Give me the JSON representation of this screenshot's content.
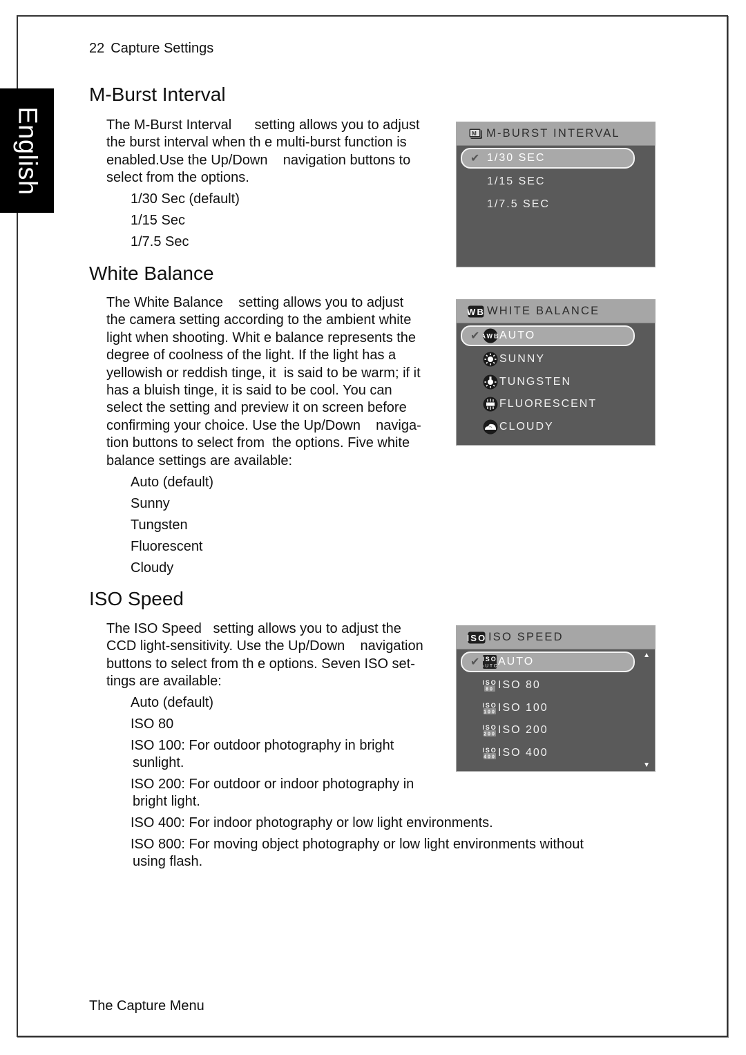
{
  "sidebar_tab": "English",
  "header": {
    "page_number": "22",
    "section": "Capture Settings"
  },
  "footer": "The Capture Menu",
  "mburst": {
    "title": "M-Burst Interval",
    "lines": [
      "The M-Burst Interval      setting allows you to adjust",
      "the burst interval when th e multi-burst function is",
      "enabled.Use the Up/Down    navigation buttons to",
      "select from the options."
    ],
    "options": [
      "1/30 Sec (default)",
      "1/15 Sec",
      "1/7.5 Sec"
    ],
    "menu": {
      "title": "M-BURST INTERVAL",
      "icon": "multi-burst-icon",
      "items": [
        {
          "label": "1/30 SEC",
          "selected": true
        },
        {
          "label": "1/15 SEC",
          "selected": false
        },
        {
          "label": "1/7.5 SEC",
          "selected": false
        }
      ]
    }
  },
  "wb": {
    "title": "White Balance",
    "lines": [
      "The White Balance    setting allows you to adjust",
      "the camera setting according to the ambient white",
      "light when shooting. Whit e balance represents the",
      "degree of coolness of the light. If the light has a",
      "yellowish or reddish tinge, it  is said to be warm; if it",
      "has a bluish tinge, it is said to be cool. You can",
      "select the setting and preview it on screen before",
      "confirming your choice. Use the Up/Down    naviga-",
      "tion buttons to select from  the options. Five white",
      "balance settings are available:"
    ],
    "options": [
      "Auto (default)",
      "Sunny",
      "Tungsten",
      "Fluorescent",
      "Cloudy"
    ],
    "menu": {
      "title": "WHITE BALANCE",
      "icon_text": "WB",
      "items": [
        {
          "label": "AUTO",
          "icon": "awb-icon",
          "icon_text": "AWB",
          "selected": true
        },
        {
          "label": "SUNNY",
          "icon": "sun-icon",
          "selected": false
        },
        {
          "label": "TUNGSTEN",
          "icon": "tungsten-bulb-icon",
          "selected": false
        },
        {
          "label": "FLUORESCENT",
          "icon": "fluorescent-icon",
          "selected": false
        },
        {
          "label": "CLOUDY",
          "icon": "cloud-icon",
          "selected": false
        }
      ]
    }
  },
  "iso": {
    "title": "ISO Speed",
    "lines": [
      "The ISO Speed   setting allows you to adjust the",
      "CCD light-sensitivity. Use the Up/Down    navigation",
      "buttons to select from th e options. Seven ISO set-",
      "tings are available:"
    ],
    "options": [
      {
        "first": "Auto (default)"
      },
      {
        "first": "ISO 80"
      },
      {
        "first": "ISO 100: For outdoor photography in bright",
        "cont": "sunlight."
      },
      {
        "first": "ISO 200: For outdoor or indoor photography in",
        "cont": "bright light."
      },
      {
        "first": "ISO 400: For indoor photography or low light environments."
      },
      {
        "first": "ISO 800: For moving object photography or low light environments without",
        "cont": "using flash."
      }
    ],
    "menu": {
      "title": "ISO SPEED",
      "icon_text": "ISO",
      "items": [
        {
          "label": "AUTO",
          "icon_top": "ISO",
          "icon_bottom": "AUTO",
          "selected": true
        },
        {
          "label": "ISO 80",
          "icon_top": "ISO",
          "icon_bottom": "80",
          "selected": false
        },
        {
          "label": "ISO 100",
          "icon_top": "ISO",
          "icon_bottom": "100",
          "selected": false
        },
        {
          "label": "ISO 200",
          "icon_top": "ISO",
          "icon_bottom": "200",
          "selected": false
        },
        {
          "label": "ISO 400",
          "icon_top": "ISO",
          "icon_bottom": "400",
          "selected": false
        }
      ],
      "scroll_up": "▲",
      "scroll_down": "▼"
    }
  },
  "check_glyph": "✔"
}
